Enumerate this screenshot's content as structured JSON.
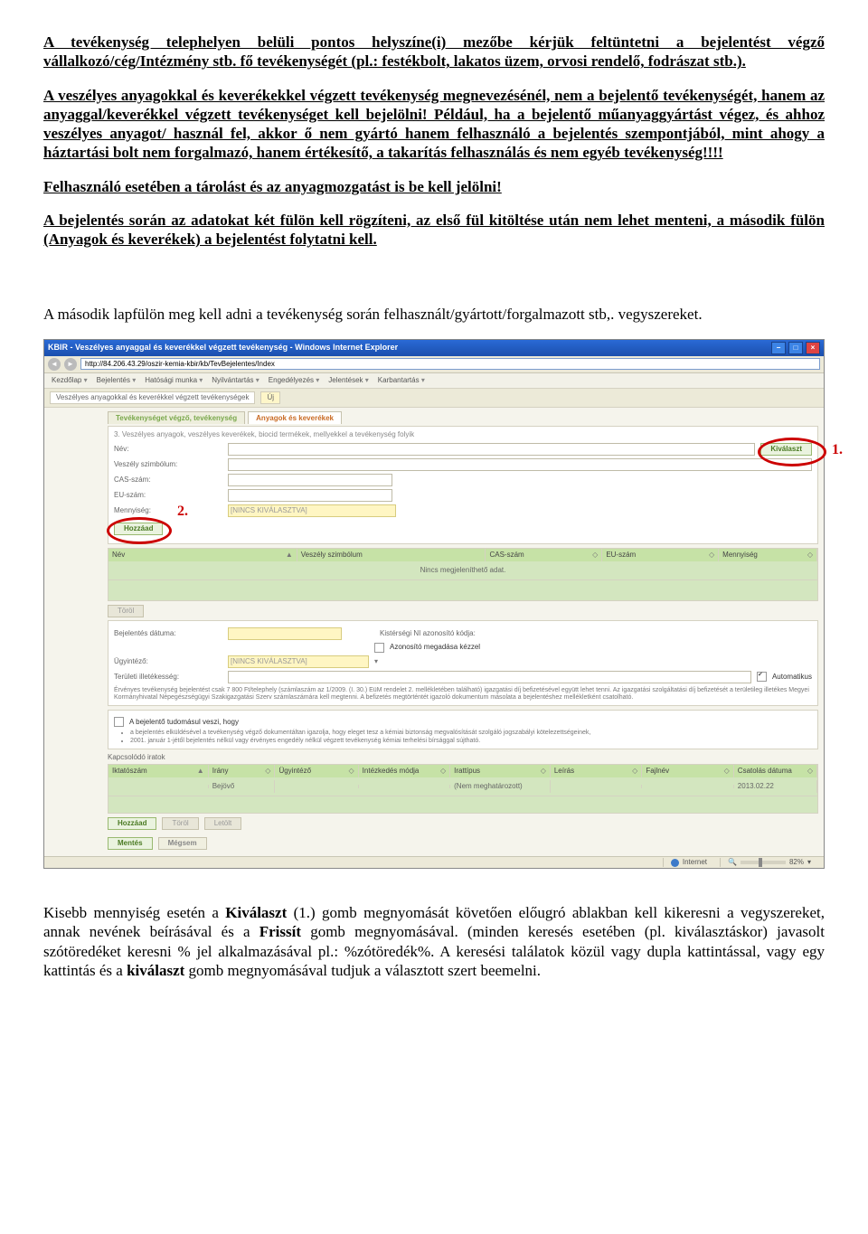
{
  "doc": {
    "p1a": "A tevékenység telephelyen belüli pontos helyszíne(i) mezőbe kérjük feltüntetni a bejelentést végző vállalkozó/cég/Intézmény stb. fő tevékenységét (pl.: festékbolt, lakatos üzem, orvosi rendelő, fodrászat stb.).",
    "p2": "A veszélyes anyagokkal és keverékekkel végzett tevékenység megnevezésénél, nem a bejelentő tevékenységét, hanem az anyaggal/keverékkel végzett tevékenységet kell bejelölni! Például, ha a bejelentő műanyaggyártást végez, és ahhoz veszélyes anyagot/ használ fel, akkor ő nem gyártó hanem felhasználó a bejelentés szempontjából, mint ahogy a háztartási bolt nem forgalmazó, hanem értékesítő, a takarítás felhasználás és nem egyéb tevékenység!!!!",
    "p3": "Felhasználó esetében a tárolást és az anyagmozgatást is be kell jelölni!",
    "p4": "A bejelentés során az adatokat két fülön kell rögzíteni, az első fül kitöltése után nem lehet menteni, a második fülön (Anyagok és keverékek) a bejelentést folytatni kell.",
    "p5": "A második lapfülön meg kell adni a tevékenység során felhasznált/gyártott/forgalmazott stb,. vegyszereket.",
    "p6a": "Kisebb mennyiség esetén a ",
    "p6_kiv": "Kiválaszt",
    "p6b": " (1.) gomb megnyomását követően előugró ablakban kell kikeresni a vegyszereket, annak nevének beírásával és a ",
    "p6_fr": "Frissít",
    "p6c": " gomb megnyomásával. (minden keresés esetében (pl. kiválasztáskor) javasolt szótöredéket keresni % jel alkalmazásával pl.: %zótöredék%. A keresési találatok közül vagy dupla kattintással, vagy egy kattintás és a ",
    "p6_kiv2": "kiválaszt",
    "p6d": " gomb megnyomásával tudjuk a választott szert beemelni."
  },
  "shot": {
    "title": "KBIR - Veszélyes anyaggal és keverékkel végzett tevékenység - Windows Internet Explorer",
    "url": "http://84.206.43.29/oszir-kemia-kbir/kb/TevBejelentes/Index",
    "menu": [
      "Kezdőlap",
      "Bejelentés",
      "Hatósági munka",
      "Nyilvántartás",
      "Engedélyezés",
      "Jelentések",
      "Karbantartás"
    ],
    "sub1": "Veszélyes anyagokkal és keverékkel végzett tevékenységek",
    "sub2": "Új",
    "tab1": "Tevékenységet végző, tevékenység",
    "tab2": "Anyagok és keverékek",
    "panel3_title": "3. Veszélyes anyagok, veszélyes keverékek, biocid termékek, mellyekkel a tevékenység folyik",
    "lbl_nev": "Név:",
    "btn_kivalaszt": "Kiválaszt",
    "lbl_vesz": "Veszély szimbólum:",
    "lbl_cas": "CAS-szám:",
    "lbl_eu": "EU-szám:",
    "lbl_menny": "Mennyiség:",
    "sel_nincs": "[NINCS KIVÁLASZTVA]",
    "btn_hozzaad": "Hozzáad",
    "g1_c1": "Név",
    "g1_c2": "Veszély szimbólum",
    "g1_c3": "CAS-szám",
    "g1_c4": "EU-szám",
    "g1_c5": "Mennyiség",
    "g1_empty": "Nincs megjeleníthető adat.",
    "btn_torol": "Töröl",
    "lbl_bejelentes": "Bejelentés dátuma:",
    "lbl_kist": "Kistérségi NI azonosító kódja:",
    "lbl_azon": "Azonosító megadása kézzel",
    "lbl_ugy": "Ügyintéző:",
    "sel_nincs2": "[NINCS KIVÁLASZTVA]",
    "lbl_terulet": "Területi illetékesség:",
    "lbl_auto": "Automatikus",
    "note1": "Érvényes tevékenység bejelentést csak 7 800 Ft/telephely (számlaszám az 1/2009. (I. 30.) EüM rendelet 2. mellékletében található) igazgatási díj befizetésével együtt lehet tenni. Az igazgatási szolgáltatási díj befizetését a területileg illetékes Megyei Kormányhivatal Népegészségügyi Szakigazgatási Szerv számlaszámára kell megtenni. A befizetés megtörténtét igazoló dokumentum másolata a bejelentéshez mellékletként csatolható.",
    "chk_title": "A bejelentő tudomásul veszi, hogy",
    "bullet1": "a bejelentés elküldésével a tevékenység végző dokumentáltan igazolja, hogy eleget tesz a kémiai biztonság megvalósítását szolgáló jogszabályi kötelezettségeinek,",
    "bullet2": "2001. január 1-jétől bejelentés nélkül vagy érvényes engedély nélkül végzett tevékenység kémiai terhelési bírsággal sújtható.",
    "kapcs": "Kapcsolódó iratok",
    "g2_c1": "Iktatószám",
    "g2_c2": "Irány",
    "g2_c3": "Ügyintéző",
    "g2_c4": "Intézkedés módja",
    "g2_c5": "Irattípus",
    "g2_c6": "Leírás",
    "g2_c7": "Fajlnév",
    "g2_c8": "Csatolás dátuma",
    "g2_row_irany": "Bejövő",
    "g2_row_irt": "(Nem meghatározott)",
    "g2_row_date": "2013.02.22",
    "btn_hozzaad2": "Hozzáad",
    "btn_torol2": "Töröl",
    "btn_letolt": "Letölt",
    "btn_mentes": "Mentés",
    "btn_megsem": "Mégsem",
    "status_internet": "Internet",
    "status_zoom": "82%"
  },
  "anno": {
    "one": "1.",
    "two": "2."
  }
}
